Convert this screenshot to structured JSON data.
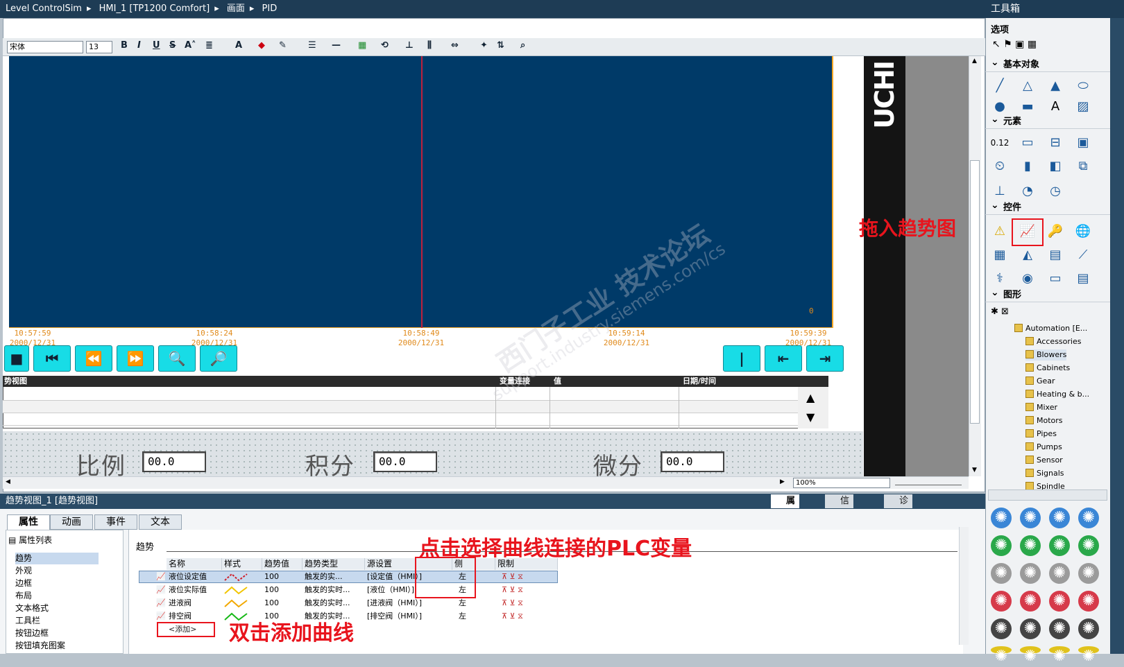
{
  "titlebar": {
    "crumbs": [
      "Level ControlSim",
      "HMI_1 [TP1200 Comfort]",
      "画面",
      "PID"
    ]
  },
  "formatbar": {
    "font": "宋体",
    "size": "13"
  },
  "trend": {
    "time_labels": [
      {
        "time": "10:57:59",
        "date": "2000/12/31"
      },
      {
        "time": "10:58:24",
        "date": "2000/12/31"
      },
      {
        "time": "10:58:49",
        "date": "2000/12/31"
      },
      {
        "time": "10:59:14",
        "date": "2000/12/31"
      },
      {
        "time": "10:59:39",
        "date": "2000/12/31"
      }
    ],
    "right_axis_zero": "0"
  },
  "trend_table": {
    "headers": [
      "势视图",
      "变量连接",
      "值",
      "日期/时间"
    ]
  },
  "vertical_text": "UCHI",
  "pid_fields": [
    {
      "label": "比例",
      "value": "00.0"
    },
    {
      "label": "积分",
      "value": "00.0"
    },
    {
      "label": "微分",
      "value": "00.0"
    }
  ],
  "zoom": "100%",
  "inspector": {
    "title": "趋势视图_1 [趋势视图]",
    "right_tabs": [
      "属性",
      "信息",
      "诊断"
    ],
    "tabs": [
      "属性",
      "动画",
      "事件",
      "文本"
    ],
    "proplist_title": "属性列表",
    "props": [
      "趋势",
      "外观",
      "边框",
      "布局",
      "文本格式",
      "工具栏",
      "按钮边框",
      "按钮填充图案"
    ],
    "section": "趋势",
    "columns": [
      "名称",
      "样式",
      "趋势值",
      "趋势类型",
      "源设置",
      "侧",
      "限制"
    ],
    "rows": [
      {
        "name": "液位设定值",
        "value": "100",
        "type": "触发的实...",
        "source": "[设定值（HMI）]",
        "side": "左",
        "color": "#d0202a"
      },
      {
        "name": "液位实际值",
        "value": "100",
        "type": "触发的实时...",
        "source": "[液位（HMI）]",
        "side": "左",
        "color": "#f2c500"
      },
      {
        "name": "进液阀",
        "value": "100",
        "type": "触发的实时...",
        "source": "[进液阀（HMI）]",
        "side": "左",
        "color": "#f2a800"
      },
      {
        "name": "排空阀",
        "value": "100",
        "type": "触发的实时...",
        "source": "[排空阀（HMI）]",
        "side": "左",
        "color": "#16b816"
      }
    ],
    "add_label": "<添加>"
  },
  "toolbox": {
    "title": "工具箱",
    "options": "选项",
    "sections": [
      "基本对象",
      "元素",
      "控件",
      "图形"
    ],
    "tree": [
      "Automation [E...",
      "Accessories",
      "Blowers",
      "Cabinets",
      "Gear",
      "Heating & b...",
      "Mixer",
      "Motors",
      "Pipes",
      "Pumps",
      "Sensor",
      "Signals",
      "Spindle"
    ]
  },
  "annotations": {
    "drag": "拖入趋势图",
    "select_plc": "点击选择曲线连接的PLC变量",
    "dblclick": "双击添加曲线"
  },
  "watermark": {
    "line1": "西门子工业 技术论坛",
    "line2": "support.industry.siemens.com/cs"
  },
  "colors": {
    "trend_bg": "#003a68",
    "accent_orange": "#f5a623",
    "button_cyan": "#18dce6",
    "annotation_red": "#e8141d"
  }
}
